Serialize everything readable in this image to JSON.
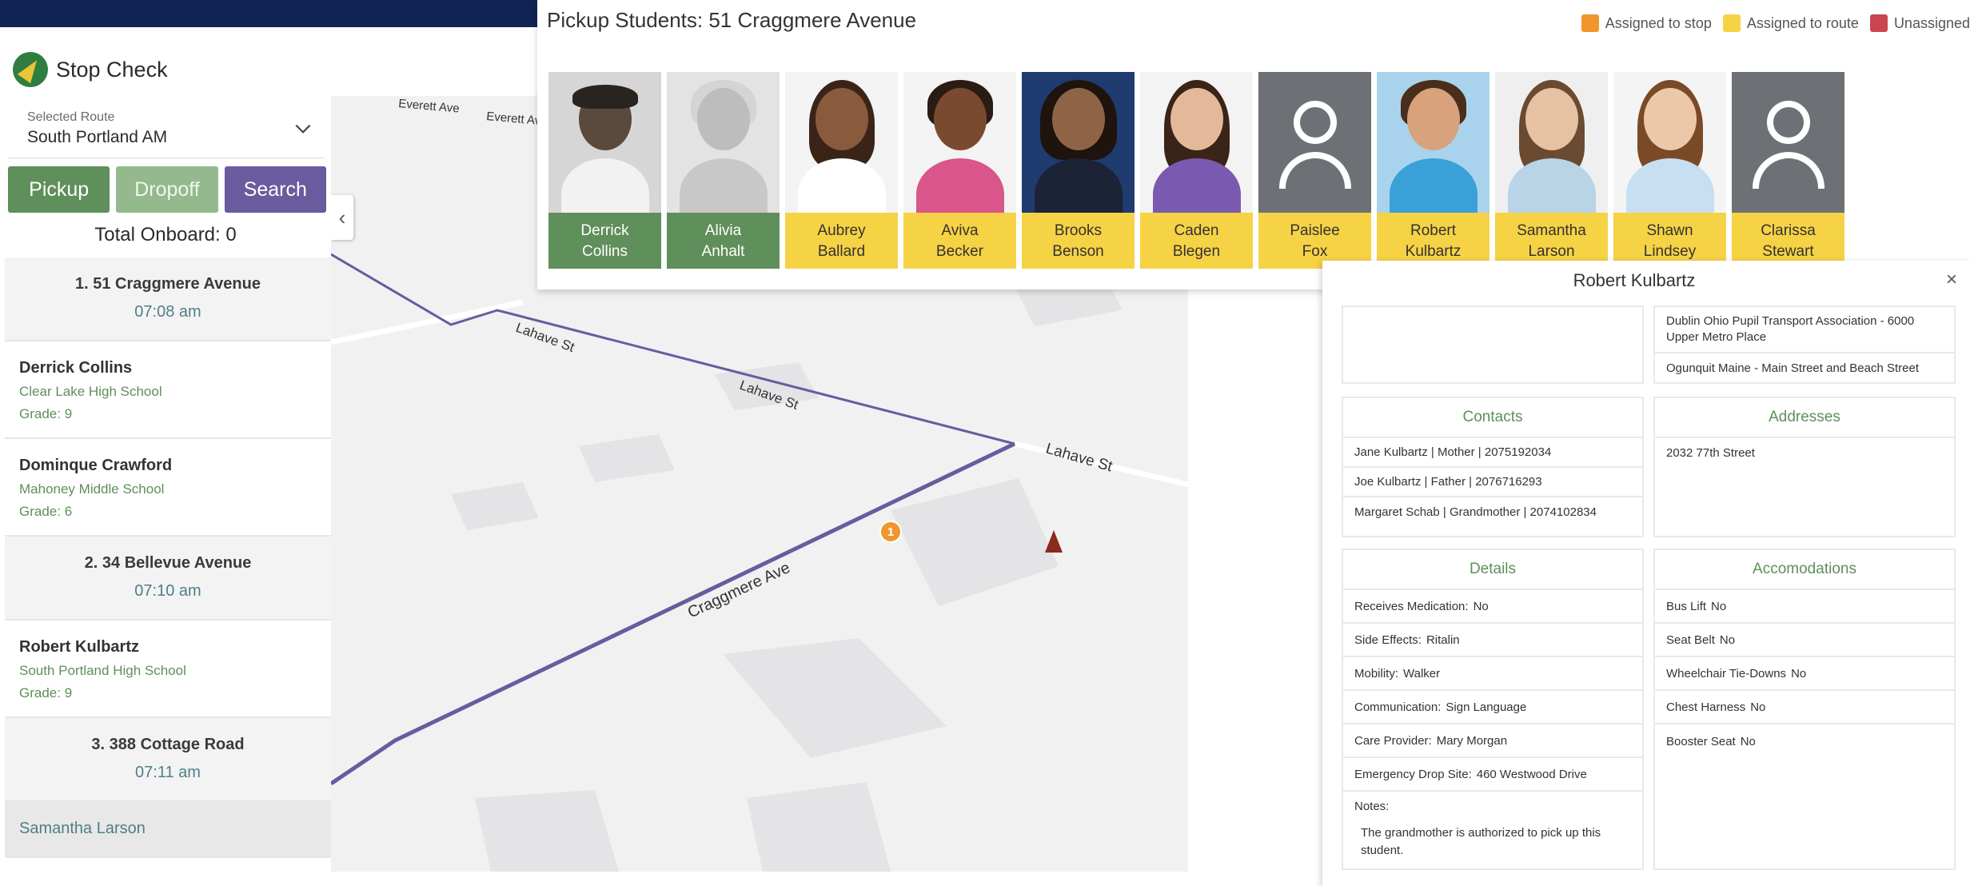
{
  "app": {
    "name": "Stop Check"
  },
  "sidebar": {
    "route_label": "Selected Route",
    "route_value": "South Portland AM",
    "tabs": {
      "pickup": "Pickup",
      "dropoff": "Dropoff",
      "search": "Search"
    },
    "total_onboard": "Total Onboard: 0",
    "stops": [
      {
        "title": "1. 51 Craggmere Avenue",
        "time": "07:08 am",
        "students": [
          {
            "name": "Derrick Collins",
            "school": "Clear Lake High School",
            "grade": "Grade: 9"
          },
          {
            "name": "Dominque Crawford",
            "school": "Mahoney Middle School",
            "grade": "Grade: 6"
          }
        ]
      },
      {
        "title": "2. 34 Bellevue Avenue",
        "time": "07:10 am",
        "students": [
          {
            "name": "Robert Kulbartz",
            "school": "South Portland High School",
            "grade": "Grade: 9"
          }
        ]
      },
      {
        "title": "3. 388 Cottage Road",
        "time": "07:11 am",
        "students": [
          {
            "name": "Samantha Larson"
          }
        ]
      }
    ]
  },
  "map": {
    "streets": [
      "Everett Ave",
      "Everett Ave",
      "Lahave St",
      "Lahave St",
      "Lahave St",
      "Craggmere Ave"
    ],
    "stop_marker": "1"
  },
  "pickup": {
    "title": "Pickup Students: 51 Craggmere Avenue",
    "legend": [
      {
        "label": "Assigned to stop",
        "color": "#f0962d"
      },
      {
        "label": "Assigned to route",
        "color": "#f6d245"
      },
      {
        "label": "Unassigned",
        "color": "#c9464e"
      }
    ],
    "students": [
      {
        "first": "Derrick",
        "last": "Collins",
        "status": "green"
      },
      {
        "first": "Alivia",
        "last": "Anhalt",
        "status": "green"
      },
      {
        "first": "Aubrey",
        "last": "Ballard",
        "status": "yellow"
      },
      {
        "first": "Aviva",
        "last": "Becker",
        "status": "yellow"
      },
      {
        "first": "Brooks",
        "last": "Benson",
        "status": "yellow"
      },
      {
        "first": "Caden",
        "last": "Blegen",
        "status": "yellow"
      },
      {
        "first": "Paislee",
        "last": "Fox",
        "status": "yellow"
      },
      {
        "first": "Robert",
        "last": "Kulbartz",
        "status": "yellow"
      },
      {
        "first": "Samantha",
        "last": "Larson",
        "status": "yellow"
      },
      {
        "first": "Shawn",
        "last": "Lindsey",
        "status": "yellow"
      },
      {
        "first": "Clarissa",
        "last": "Stewart",
        "status": "yellow"
      }
    ]
  },
  "detail": {
    "title": "Robert Kulbartz",
    "close": "×",
    "stops": [
      "Dublin Ohio Pupil Transport Association - 6000 Upper Metro Place",
      "Ogunquit Maine - Main Street and Beach Street"
    ],
    "contacts_title": "Contacts",
    "contacts": [
      "Jane Kulbartz | Mother | 2075192034",
      "Joe Kulbartz | Father | 2076716293",
      "Margaret Schab | Grandmother | 2074102834"
    ],
    "addresses_title": "Addresses",
    "addresses": [
      "2032 77th Street"
    ],
    "details_title": "Details",
    "details": [
      {
        "label": "Receives Medication:",
        "value": "No"
      },
      {
        "label": "Side Effects:",
        "value": "Ritalin"
      },
      {
        "label": "Mobility:",
        "value": "Walker"
      },
      {
        "label": "Communication:",
        "value": "Sign Language"
      },
      {
        "label": "Care Provider:",
        "value": "Mary Morgan"
      },
      {
        "label": "Emergency Drop Site:",
        "value": "460 Westwood Drive"
      }
    ],
    "notes_label": "Notes:",
    "notes": "The grandmother is authorized to pick up this student.",
    "accommodations_title": "Accomodations",
    "accommodations": [
      {
        "label": "Bus Lift",
        "value": "No"
      },
      {
        "label": "Seat Belt",
        "value": "No"
      },
      {
        "label": "Wheelchair Tie-Downs",
        "value": "No"
      },
      {
        "label": "Chest Harness",
        "value": "No"
      },
      {
        "label": "Booster Seat",
        "value": "No"
      }
    ]
  }
}
